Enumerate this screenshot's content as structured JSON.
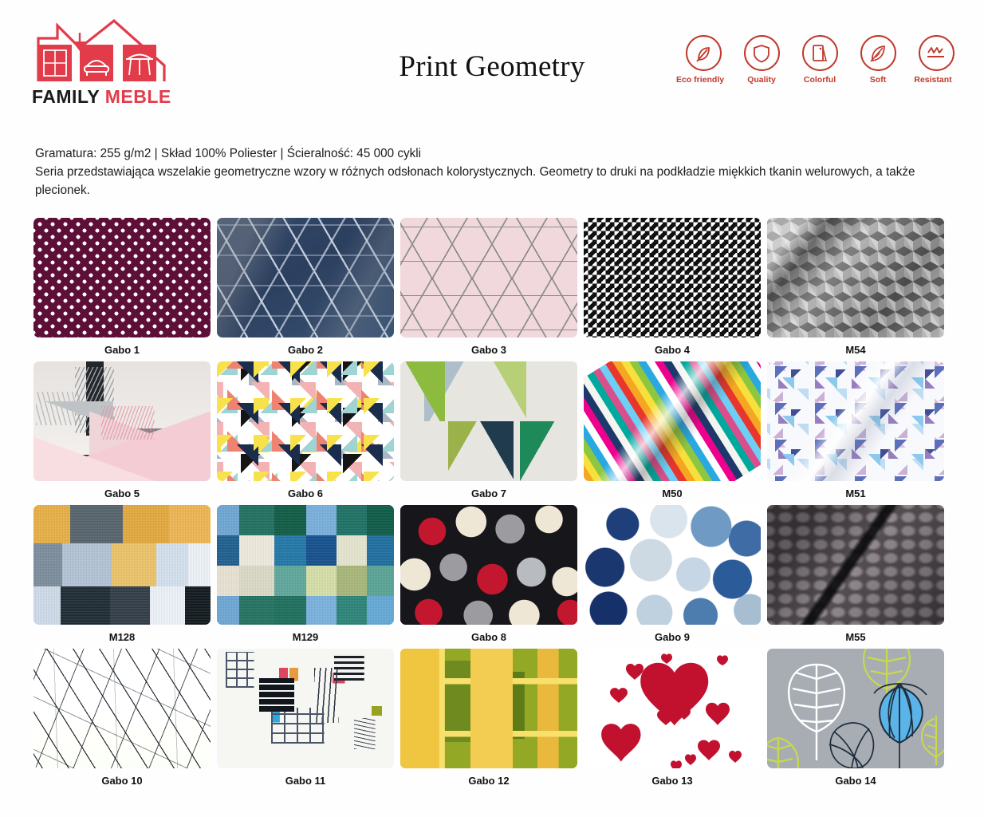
{
  "brand": {
    "name_first": "FAMILY",
    "name_second": "MEBLE",
    "logo_icon": "house-furniture-logo"
  },
  "header": {
    "title": "Print Geometry",
    "badges": [
      {
        "label": "Eco friendly",
        "icon": "leaf-icon"
      },
      {
        "label": "Quality",
        "icon": "shield-icon"
      },
      {
        "label": "Colorful",
        "icon": "color-swatch-icon"
      },
      {
        "label": "Soft",
        "icon": "feather-icon"
      },
      {
        "label": "Resistant",
        "icon": "abrasion-icon"
      }
    ],
    "accent_color": "#c0392b",
    "brand_red": "#e23b4a"
  },
  "description": {
    "line1": "Gramatura: 255 g/m2 | Skład 100% Poliester | Ścieralność: 45 000 cykli",
    "line2": "Seria przedstawiająca wszelakie geometryczne wzory w różnych odsłonach kolorystycznych. Geometry to druki na podkładzie miękkich tkanin welurowych, a także plecionek."
  },
  "swatches": [
    {
      "label": "Gabo 1",
      "pattern": "p-gabo1",
      "desc": "maroon polka dot"
    },
    {
      "label": "Gabo 2",
      "pattern": "p-gabo2",
      "desc": "navy cube geometric"
    },
    {
      "label": "Gabo 3",
      "pattern": "p-gabo3",
      "desc": "pink grey geometric lines"
    },
    {
      "label": "Gabo 4",
      "pattern": "p-gabo4",
      "desc": "black white houndstooth"
    },
    {
      "label": "M54",
      "pattern": "p-m54",
      "desc": "grey 3d cubes"
    },
    {
      "label": "Gabo 5",
      "pattern": "p-gabo5",
      "desc": "pastel pink grey abstract"
    },
    {
      "label": "Gabo 6",
      "pattern": "p-gabo6",
      "desc": "multicolor triangles"
    },
    {
      "label": "Gabo 7",
      "pattern": "p-gabo7",
      "desc": "green grey triangles"
    },
    {
      "label": "M50",
      "pattern": "p-m50",
      "desc": "multicolor pixel mosaic"
    },
    {
      "label": "M51",
      "pattern": "p-m51",
      "desc": "pale blue purple triangles"
    },
    {
      "label": "M128",
      "pattern": "p-m128",
      "desc": "yellow blue grey squares"
    },
    {
      "label": "M129",
      "pattern": "p-m129",
      "desc": "teal green cream squares"
    },
    {
      "label": "Gabo 8",
      "pattern": "p-gabo8",
      "desc": "black red cream rounded shapes"
    },
    {
      "label": "Gabo 9",
      "pattern": "p-gabo9",
      "desc": "blue watercolor circles"
    },
    {
      "label": "M55",
      "pattern": "p-m55",
      "desc": "grey quilted diamond"
    },
    {
      "label": "Gabo 10",
      "pattern": "p-gabo10",
      "desc": "white marble"
    },
    {
      "label": "Gabo 11",
      "pattern": "p-gabo11",
      "desc": "collage blocks"
    },
    {
      "label": "Gabo 12",
      "pattern": "p-gabo12",
      "desc": "green yellow plaid"
    },
    {
      "label": "Gabo 13",
      "pattern": "p-gabo13",
      "desc": "red hearts on white"
    },
    {
      "label": "Gabo 14",
      "pattern": "p-gabo14",
      "desc": "grey leaves botanical"
    }
  ]
}
